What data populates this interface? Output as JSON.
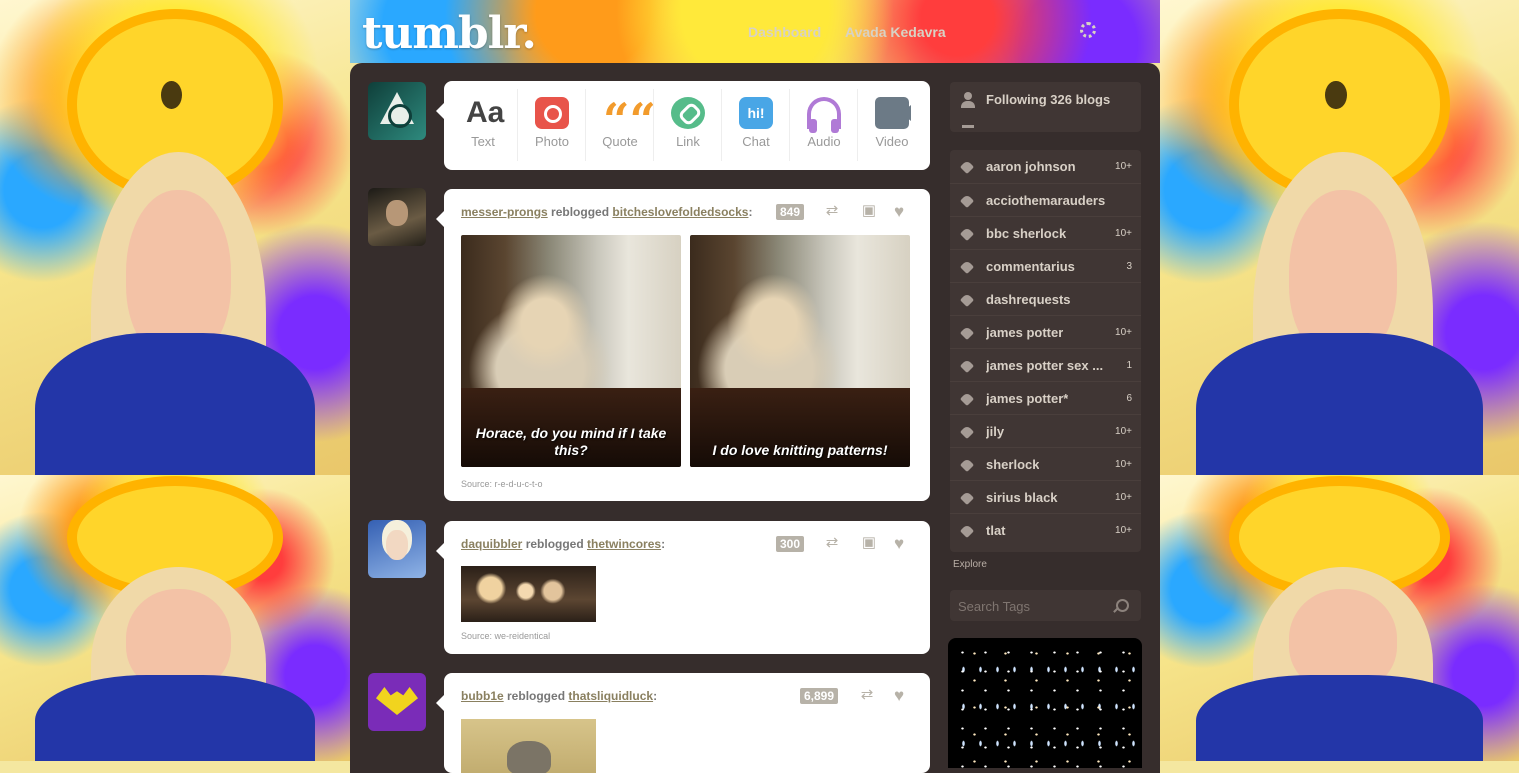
{
  "header": {
    "logo": "tumblr.",
    "nav": [
      "Dashboard",
      "Avada Kedavra"
    ]
  },
  "composer": [
    {
      "label": "Text",
      "icon": "text-icon"
    },
    {
      "label": "Photo",
      "icon": "photo-icon"
    },
    {
      "label": "Quote",
      "icon": "quote-icon"
    },
    {
      "label": "Link",
      "icon": "link-icon"
    },
    {
      "label": "Chat",
      "icon": "chat-icon"
    },
    {
      "label": "Audio",
      "icon": "audio-icon"
    },
    {
      "label": "Video",
      "icon": "video-icon"
    }
  ],
  "composer_glyphs": {
    "text": "Aa",
    "quote": "““",
    "chat": "hi!"
  },
  "posts": [
    {
      "user": "messer-prongs",
      "action": "reblogged",
      "source_blog": "bitcheslovefoldedsocks",
      "notes": "849",
      "captions": [
        "Horace, do you mind if I take this?",
        "I do love knitting patterns!"
      ],
      "source_label": "Source:",
      "source": "r-e-d-u-c-t-o"
    },
    {
      "user": "daquibbler",
      "action": "reblogged",
      "source_blog": "thetwincores",
      "notes": "300",
      "source_label": "Source:",
      "source": "we-reidentical"
    },
    {
      "user": "bubb1e",
      "action": "reblogged",
      "source_blog": "thatsliquidluck",
      "notes": "6,899"
    }
  ],
  "sidebar": {
    "following": "Following 326 blogs",
    "tags": [
      {
        "name": "aaron johnson",
        "count": "10+"
      },
      {
        "name": "acciothemarauders",
        "count": ""
      },
      {
        "name": "bbc sherlock",
        "count": "10+"
      },
      {
        "name": "commentarius",
        "count": "3"
      },
      {
        "name": "dashrequests",
        "count": ""
      },
      {
        "name": "james potter",
        "count": "10+"
      },
      {
        "name": "james potter sex ...",
        "count": "1"
      },
      {
        "name": "james potter*",
        "count": "6"
      },
      {
        "name": "jily",
        "count": "10+"
      },
      {
        "name": "sherlock",
        "count": "10+"
      },
      {
        "name": "sirius black",
        "count": "10+"
      },
      {
        "name": "tlat",
        "count": "10+"
      }
    ],
    "explore": "Explore",
    "search_placeholder": "Search Tags"
  },
  "colors": {
    "panel": "#362d2c",
    "sidebar_box": "#403634",
    "username": "#8a8060"
  }
}
